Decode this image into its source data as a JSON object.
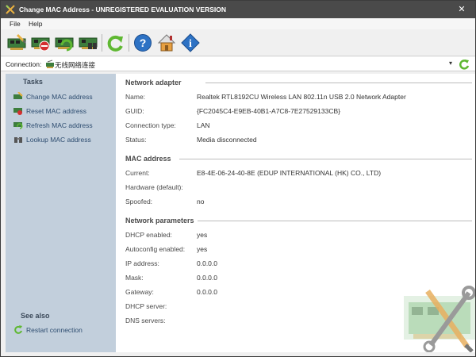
{
  "window": {
    "title": "Change MAC Address - UNREGISTERED EVALUATION VERSION",
    "close_glyph": "✕",
    "app_icon": "mac-tool-icon"
  },
  "menu": {
    "file": "File",
    "help": "Help"
  },
  "toolbar": {
    "buttons": [
      "change-mac-icon",
      "reset-mac-icon",
      "refresh-mac-icon",
      "lookup-mac-icon",
      "restart-connection-icon",
      "help-icon",
      "home-icon",
      "info-icon"
    ]
  },
  "connection": {
    "label": "Connection:",
    "value": "无线网络连接",
    "dropdown_glyph": "▾"
  },
  "sidebar": {
    "tasks_header": "Tasks",
    "tasks": [
      "Change MAC address",
      "Reset MAC address",
      "Refresh MAC address",
      "Lookup MAC address"
    ],
    "see_also_header": "See also",
    "see_also": [
      "Restart connection"
    ]
  },
  "network_adapter": {
    "header": "Network adapter",
    "name_label": "Name:",
    "name": "Realtek RTL8192CU Wireless LAN 802.11n USB 2.0 Network Adapter",
    "guid_label": "GUID:",
    "guid": "{FC2045C4-E9EB-40B1-A7C8-7E27529133CB}",
    "conn_type_label": "Connection type:",
    "conn_type": "LAN",
    "status_label": "Status:",
    "status": "Media disconnected"
  },
  "mac_address": {
    "header": "MAC address",
    "current_label": "Current:",
    "current": "E8-4E-06-24-40-8E (EDUP INTERNATIONAL (HK) CO., LTD)",
    "hardware_label": "Hardware (default):",
    "hardware": "",
    "spoofed_label": "Spoofed:",
    "spoofed": "no"
  },
  "network_parameters": {
    "header": "Network parameters",
    "dhcp_label": "DHCP enabled:",
    "dhcp": "yes",
    "autoconfig_label": "Autoconfig enabled:",
    "autoconfig": "yes",
    "ip_label": "IP address:",
    "ip": "0.0.0.0",
    "mask_label": "Mask:",
    "mask": "0.0.0.0",
    "gateway_label": "Gateway:",
    "gateway": "0.0.0.0",
    "dhcp_server_label": "DHCP server:",
    "dhcp_server": "",
    "dns_label": "DNS servers:",
    "dns": ""
  },
  "colors": {
    "titlebar": "#4a4a4a",
    "sidebar": "#c2cfdc",
    "link": "#2e4d70",
    "green": "#5fb832",
    "blue": "#2d72c4"
  }
}
